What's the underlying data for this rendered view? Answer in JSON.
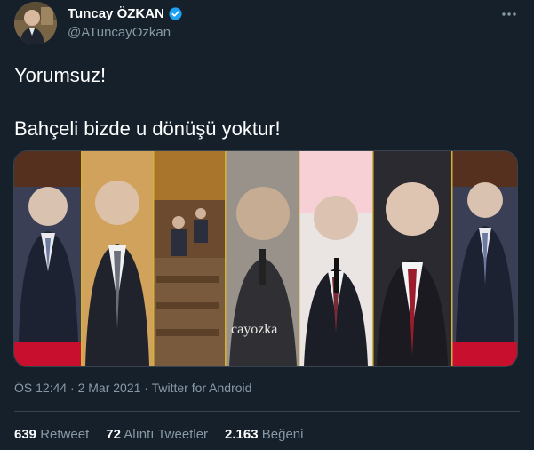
{
  "author": {
    "display_name": "Tuncay ÖZKAN",
    "handle": "@ATuncayOzkan",
    "verified_icon": "verified-badge-icon"
  },
  "tweet": {
    "line1": "Yorumsuz!",
    "line2": "Bahçeli bizde u dönüşü yoktur!",
    "media_watermark": "cayozka"
  },
  "meta": {
    "time_date_source": "ÖS 12:44 · 2 Mar 2021 · Twitter for Android"
  },
  "stats": {
    "retweets": {
      "count": "639",
      "label": "Retweet"
    },
    "quotes": {
      "count": "72",
      "label": "Alıntı Tweetler"
    },
    "likes": {
      "count": "2.163",
      "label": "Beğeni"
    }
  },
  "colors": {
    "background": "#15202b",
    "secondary_text": "#8899a6",
    "verified": "#1da1f2",
    "border": "#38444d"
  }
}
